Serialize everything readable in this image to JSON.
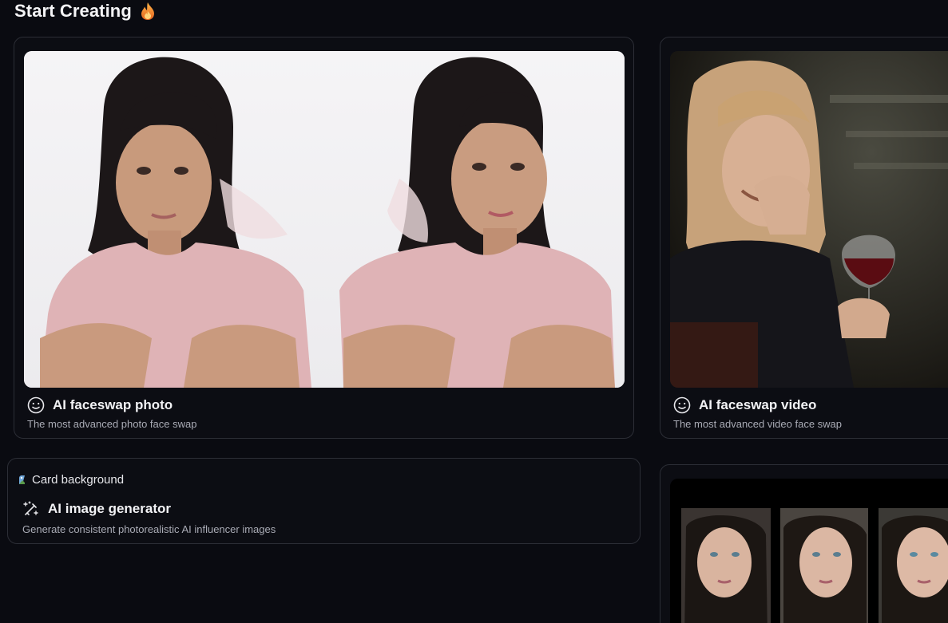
{
  "section": {
    "title": "Start Creating",
    "title_icon": "fire-icon"
  },
  "cards": [
    {
      "title": "AI faceswap photo",
      "subtitle": "The most advanced photo face swap",
      "icon": "smiley-face-icon",
      "image": "two-women-pink-shirt-photo"
    },
    {
      "title": "AI faceswap video",
      "subtitle": "The most advanced video face swap",
      "icon": "smiley-face-icon",
      "image": "woman-laughing-wine-glass-photo"
    },
    {
      "title": "AI image generator",
      "subtitle": "Generate consistent photorealistic AI influencer images",
      "icon": "magic-wand-icon",
      "image_alt": "Card background"
    },
    {
      "image": "three-women-portraits-photo"
    }
  ],
  "colors": {
    "background": "#0a0b11",
    "card_border": "#2c2e36",
    "text_primary": "#f2f2f5",
    "text_secondary": "#a9abb5",
    "accent_fire": "#f5a623"
  }
}
